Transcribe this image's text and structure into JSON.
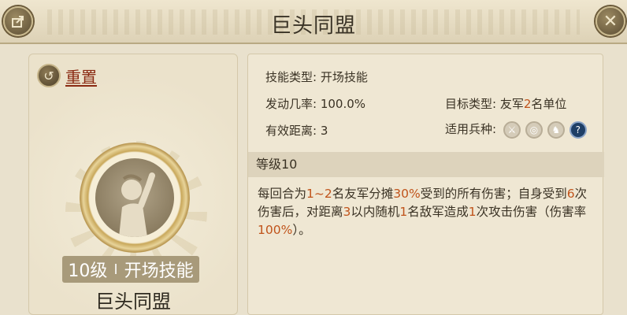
{
  "window": {
    "title": "巨头同盟"
  },
  "left": {
    "reset_label": "重置",
    "level_text": "10级",
    "level_separator": "I",
    "skill_type": "开场技能",
    "skill_name": "巨头同盟"
  },
  "info": {
    "skill_type_label": "技能类型:",
    "skill_type_value": "开场技能",
    "trigger_label": "发动几率:",
    "trigger_value": "100.0%",
    "target_label": "目标类型:",
    "target_prefix": "友军",
    "target_num": "2",
    "target_suffix": "名单位",
    "range_label": "有效距离:",
    "range_value": "3",
    "troop_label": "适用兵种:",
    "troops": [
      "sword-icon",
      "bow-icon",
      "horse-icon",
      "question-icon"
    ]
  },
  "level_header": "等级10",
  "description": {
    "p1": "每回合为",
    "h1": "1~2",
    "p2": "名友军分摊",
    "h2": "30%",
    "p3": "受到的所有伤害；自身受到",
    "h3": "6",
    "p4": "次伤害后，对距离",
    "h4": "3",
    "p5": "以内随机",
    "h5": "1",
    "p6": "名敌军造成",
    "h6": "1",
    "p7": "次攻击伤害（伤害率",
    "h7": "100%",
    "p8": "）。"
  },
  "colors": {
    "highlight": "#c0541b",
    "reset_link": "#8a2a12"
  }
}
